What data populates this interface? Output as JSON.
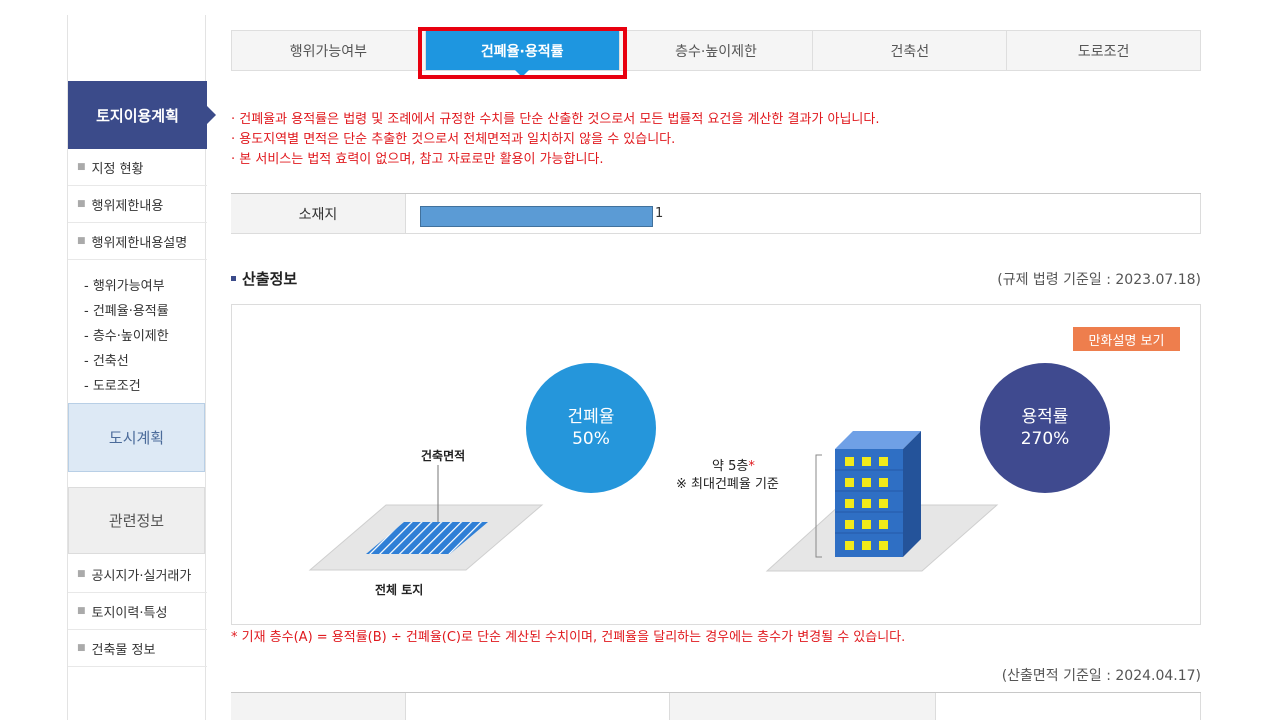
{
  "sidebar": {
    "head": "토지이용계획",
    "items": [
      "지정 현황",
      "행위제한내용",
      "행위제한내용설명"
    ],
    "sub_items": [
      "- 행위가능여부",
      "- 건폐율·용적률",
      "- 층수·높이제한",
      "- 건축선",
      "- 도로조건"
    ],
    "city_plan": "도시계획",
    "related": "관련정보",
    "related_items": [
      "공시지가·실거래가",
      "토지이력·특성",
      "건축물 정보"
    ]
  },
  "tabs": [
    "행위가능여부",
    "건폐율·용적률",
    "층수·높이제한",
    "건축선",
    "도로조건"
  ],
  "active_tab": 1,
  "notices": [
    "· 건폐율과 용적률은 법령 및 조례에서 규정한 수치를 단순 산출한 것으로서 모든 법률적 요건을 계산한 결과가 아닙니다.",
    "· 용도지역별 면적은 단순 추출한 것으로서 전체면적과 일치하지 않을 수 있습니다.",
    "· 본 서비스는 법적 효력이 없으며, 참고 자료로만 활용이 가능합니다."
  ],
  "location": {
    "label": "소재지",
    "suffix": "1"
  },
  "section": {
    "title": "산출정보",
    "date": "(규제 법령 기준일 : 2023.07.18)"
  },
  "diagram": {
    "cartoon_button": "만화설명 보기",
    "bcr_label": "건폐율",
    "bcr_value": "50%",
    "far_label": "용적률",
    "far_value": "270%",
    "building_area": "건축면적",
    "total_land": "전체 토지",
    "floors": "약 5층",
    "floors_star": "*",
    "floors_note": "※ 최대건폐율 기준"
  },
  "formula_note": "* 기재 층수(A) = 용적률(B) ÷ 건폐율(C)로 단순 계산된 수치이며, 건폐율을 달리하는 경우에는 층수가 변경될 수 있습니다.",
  "area_date": "(산출면적 기준일 : 2024.04.17)",
  "colors": {
    "accent": "#1e96e0",
    "sidebar": "#3b4b8a",
    "notice": "#e0191e",
    "highlight": "#e8000f",
    "button": "#ee7e4d"
  }
}
